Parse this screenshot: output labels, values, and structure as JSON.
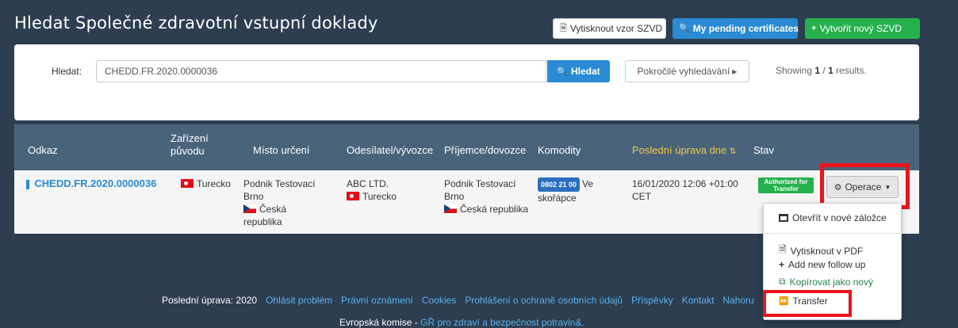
{
  "header": {
    "title": "Hledat Společné zdravotní vstupní doklady",
    "print_template_label": "Vytisknout vzor SZVD",
    "pending_label": "My pending certificates",
    "new_label": "Vytvořit nový SZVD"
  },
  "search": {
    "label": "Hledat:",
    "value": "CHEDD.FR.2020.0000036",
    "button_label": "Hledat",
    "advanced_label": "Pokročilé vyhledávání",
    "showing_prefix": "Showing",
    "showing_current": "1",
    "showing_sep": "/",
    "showing_total": "1",
    "showing_suffix": "results."
  },
  "table": {
    "headers": {
      "ref": "Odkaz",
      "origin": "Zařízení původu",
      "destination": "Místo určení",
      "consignor": "Odesílatel/vývozce",
      "consignee": "Příjemce/dovozce",
      "commodities": "Komodity",
      "last_update": "Poslední úprava dne",
      "status": "Stav"
    },
    "row": {
      "ref": "CHEDD.FR.2020.0000036",
      "origin": "Turecko",
      "destination_line1": "Podnik Testovací",
      "destination_line2": "Brno",
      "destination_country_a": "Česká",
      "destination_country_b": "republika",
      "consignor_name": "ABC LTD.",
      "consignor_country": "Turecko",
      "consignee_line1": "Podnik Testovací",
      "consignee_line2": "Brno",
      "consignee_country": "Česká republika",
      "commodity_code": "0802 21 00",
      "commodity_text_a": "Ve",
      "commodity_text_b": "skořápce",
      "last_update_a": "16/01/2020 12:06 +01:00",
      "last_update_b": "CET",
      "status_line1": "Authorized for",
      "status_line2": "Transfer",
      "operations_label": "Operace"
    }
  },
  "dropdown": {
    "open_new_tab": "Otevřít v nové záložce",
    "print_pdf": "Vytisknout v PDF",
    "add_follow_up": "Add new follow up",
    "copy_as_new": "Kopírovat jako nový",
    "transfer": "Transfer"
  },
  "footer": {
    "last_update": "Poslední úprava: 2020",
    "report_problem": "Ohlásit problém",
    "legal_notice": "Právní oznámení",
    "cookies": "Cookies",
    "privacy": "Prohlášení o ochraně osobních údajů",
    "contributions": "Příspěvky",
    "contact": "Kontakt",
    "help": "Nahoru",
    "commission": "Evropská komise -",
    "dg": "GŘ pro zdraví a bezpečnost potravin&."
  },
  "colors": {
    "background": "#2c3e50",
    "primary": "#2a8bd4",
    "success": "#27b14e",
    "highlight": "#e8141b",
    "header_gold": "#f4c84a"
  }
}
